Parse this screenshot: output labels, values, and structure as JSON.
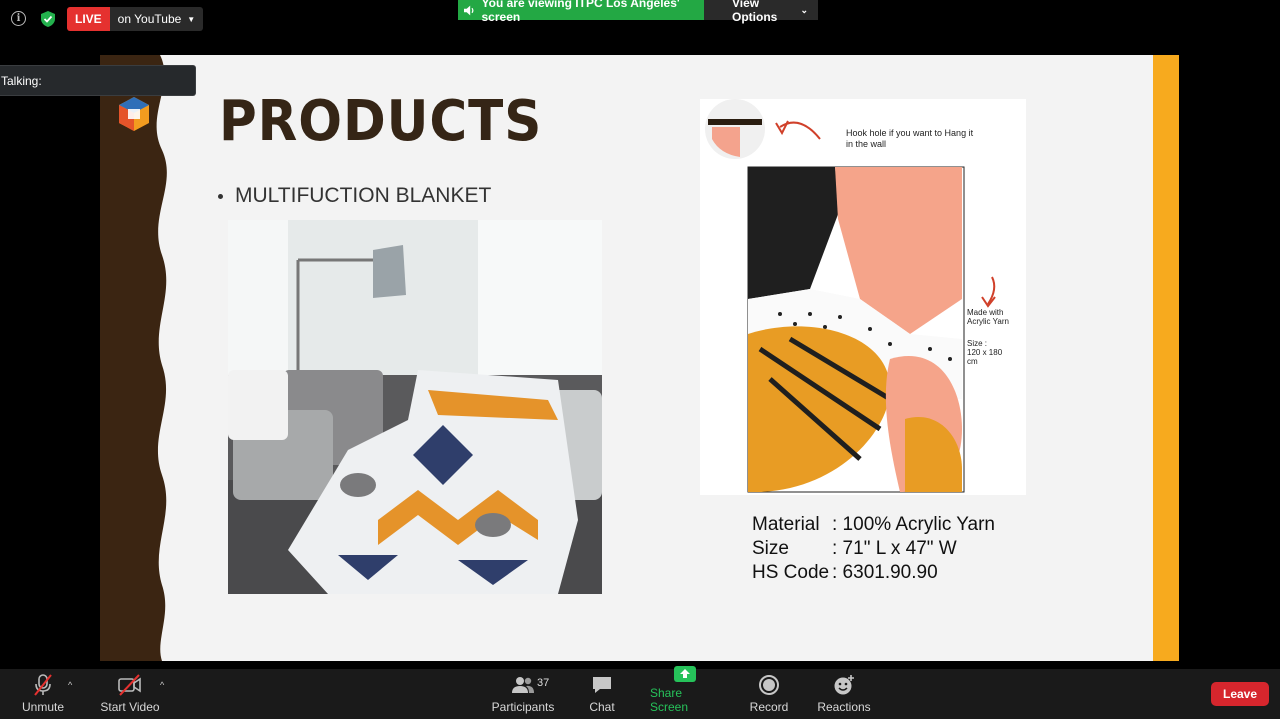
{
  "top_bar": {
    "info_glyph": "i",
    "live_label": "LIVE",
    "live_target": "on YouTube",
    "viewing_banner": "You are viewing ITPC Los Angeles' screen",
    "view_options": "View Options"
  },
  "talking_label": "Talking:",
  "slide": {
    "title": "PRODUCTS",
    "bullet": "MULTIFUCTION BLANKET",
    "diagram_notes": {
      "hook": "Hook hole if you want to Hang it in the wall",
      "made_with": "Made with Acrylic Yarn",
      "size": "Size : 120 x 180 cm"
    },
    "specs": [
      {
        "key": "Material",
        "value": ": 100% Acrylic Yarn"
      },
      {
        "key": "Size",
        "value": ": 71\" L x 47\"  W"
      },
      {
        "key": "HS Code",
        "value": ": 6301.90.90"
      }
    ],
    "accent_color": "#f7aa1e",
    "brown_color": "#3b2512"
  },
  "toolbar": {
    "unmute": "Unmute",
    "start_video": "Start Video",
    "participants": "Participants",
    "participants_count": "37",
    "chat": "Chat",
    "share_screen": "Share Screen",
    "record": "Record",
    "reactions": "Reactions",
    "leave": "Leave"
  },
  "colors": {
    "live_red": "#e5312f",
    "banner_green": "#23a844",
    "leave_red": "#d6262d",
    "share_green": "#26c25a"
  }
}
